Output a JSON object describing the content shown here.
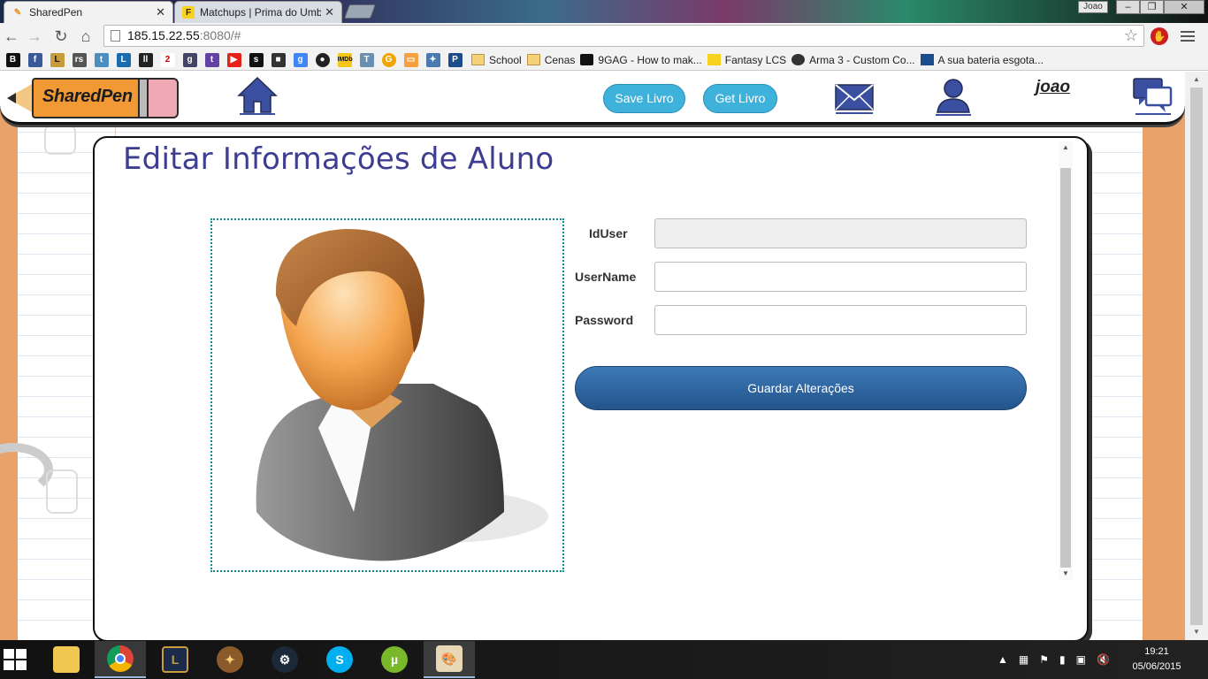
{
  "browser": {
    "tabs": [
      {
        "label": "SharedPen",
        "active": true
      },
      {
        "label": "Matchups | Prima do Umb",
        "active": false
      }
    ],
    "window_user": "Joao",
    "url_host": "185.15.22.55",
    "url_rest": ":8080/#",
    "bookmarks": [
      {
        "label": "School",
        "type": "folder"
      },
      {
        "label": "Cenas",
        "type": "folder"
      },
      {
        "label": "9GAG - How to mak...",
        "type": "link"
      },
      {
        "label": "Fantasy LCS",
        "type": "link"
      },
      {
        "label": "Arma 3 - Custom Co...",
        "type": "link"
      },
      {
        "label": "A sua bateria esgota...",
        "type": "link"
      }
    ]
  },
  "header": {
    "logo_text": "SharedPen",
    "save_button": "Save Livro",
    "get_button": "Get Livro",
    "username": "joao"
  },
  "main": {
    "title": "Editar Informações de Aluno",
    "form": {
      "iduser_label": "IdUser",
      "iduser_value": "",
      "username_label": "UserName",
      "username_value": "",
      "password_label": "Password",
      "password_value": "",
      "submit_label": "Guardar Alterações"
    }
  },
  "taskbar": {
    "time": "19:21",
    "date": "05/06/2015"
  },
  "colors": {
    "title": "#3d3d92",
    "pill": "#3fb2dc",
    "primary_button": "#2d67a0",
    "page_border": "#e8a26a",
    "photo_border": "#0b8c8c"
  }
}
